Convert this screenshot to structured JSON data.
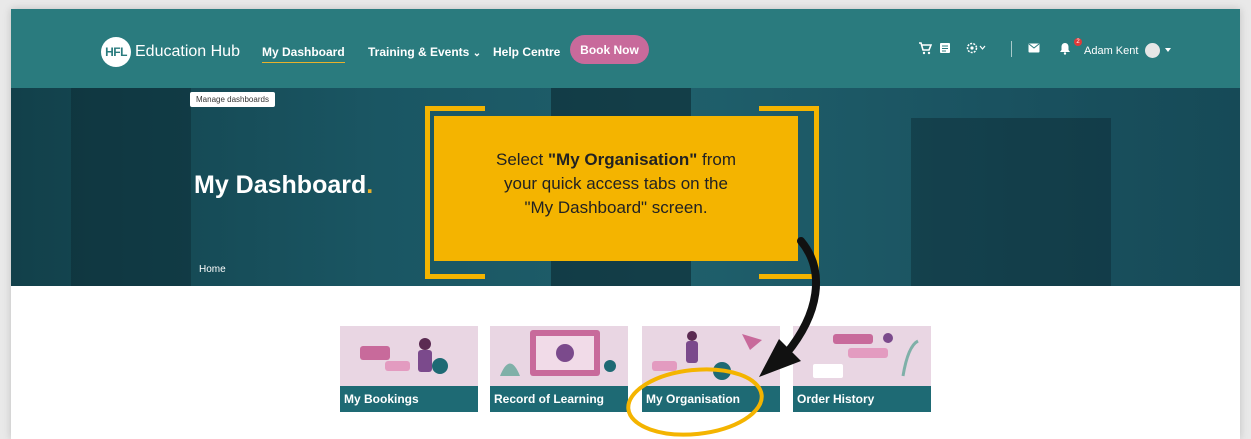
{
  "nav": {
    "logo_badge": "HFL",
    "logo_text": "Education Hub",
    "links": [
      "My Dashboard",
      "Training & Events",
      "Help Centre"
    ],
    "dropdown_caret": "⌄",
    "book_now": "Book Now",
    "user_name": "Adam Kent",
    "notification_count": "2",
    "icons": [
      "cart-icon",
      "orders-icon",
      "settings-icon",
      "mail-icon",
      "bell-icon",
      "avatar",
      "caret-down-icon"
    ]
  },
  "hero": {
    "manage_dashboards": "Manage dashboards",
    "title": "My Dashboard",
    "title_dot": ".",
    "breadcrumb": "Home"
  },
  "callout": {
    "line1_pre": "Select ",
    "line1_bold": "\"My Organisation\"",
    "line1_post": " from",
    "line2": "your quick access tabs on the",
    "line3": "\"My Dashboard\" screen."
  },
  "tiles": [
    {
      "label": "My Bookings"
    },
    {
      "label": "Record of Learning"
    },
    {
      "label": "My Organisation"
    },
    {
      "label": "Order History"
    }
  ],
  "colors": {
    "nav_bg": "#2a7b7e",
    "accent_yellow": "#f4b400",
    "book_btn": "#c86a9b",
    "tile_label_bg": "#1e6a74",
    "tile_bg": "#e9d6e3"
  }
}
